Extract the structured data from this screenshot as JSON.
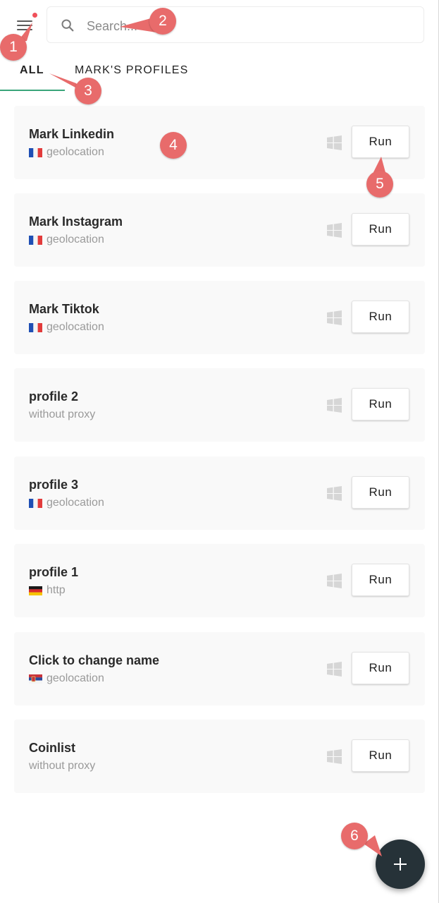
{
  "search": {
    "placeholder": "Search..."
  },
  "tabs": [
    {
      "label": "ALL",
      "active": true
    },
    {
      "label": "MARK'S PROFILES",
      "active": false
    }
  ],
  "profiles": [
    {
      "name": "Mark Linkedin",
      "proxy": "geolocation",
      "flag": "fr",
      "os_icon": "windows-icon",
      "button": "Run"
    },
    {
      "name": "Mark Instagram",
      "proxy": "geolocation",
      "flag": "fr",
      "os_icon": "windows-icon",
      "button": "Run"
    },
    {
      "name": "Mark Tiktok",
      "proxy": "geolocation",
      "flag": "fr",
      "os_icon": "windows-icon",
      "button": "Run"
    },
    {
      "name": "profile 2",
      "proxy": "without proxy",
      "flag": null,
      "os_icon": "windows-icon",
      "button": "Run"
    },
    {
      "name": "profile 3",
      "proxy": "geolocation",
      "flag": "fr",
      "os_icon": "windows-icon",
      "button": "Run"
    },
    {
      "name": "profile 1",
      "proxy": "http",
      "flag": "de",
      "os_icon": "windows-icon",
      "button": "Run"
    },
    {
      "name": "Click to change name",
      "proxy": "geolocation",
      "flag": "rs",
      "os_icon": "windows-icon",
      "button": "Run"
    },
    {
      "name": "Coinlist",
      "proxy": "without proxy",
      "flag": null,
      "os_icon": "windows-icon",
      "button": "Run"
    }
  ],
  "callouts": [
    "1",
    "2",
    "3",
    "4",
    "5",
    "6"
  ],
  "colors": {
    "accent": "#3aa57a",
    "fab": "#263238",
    "callout": "#e86b6b",
    "notification_dot": "#f0505a",
    "card_bg": "#f9f9f9"
  }
}
